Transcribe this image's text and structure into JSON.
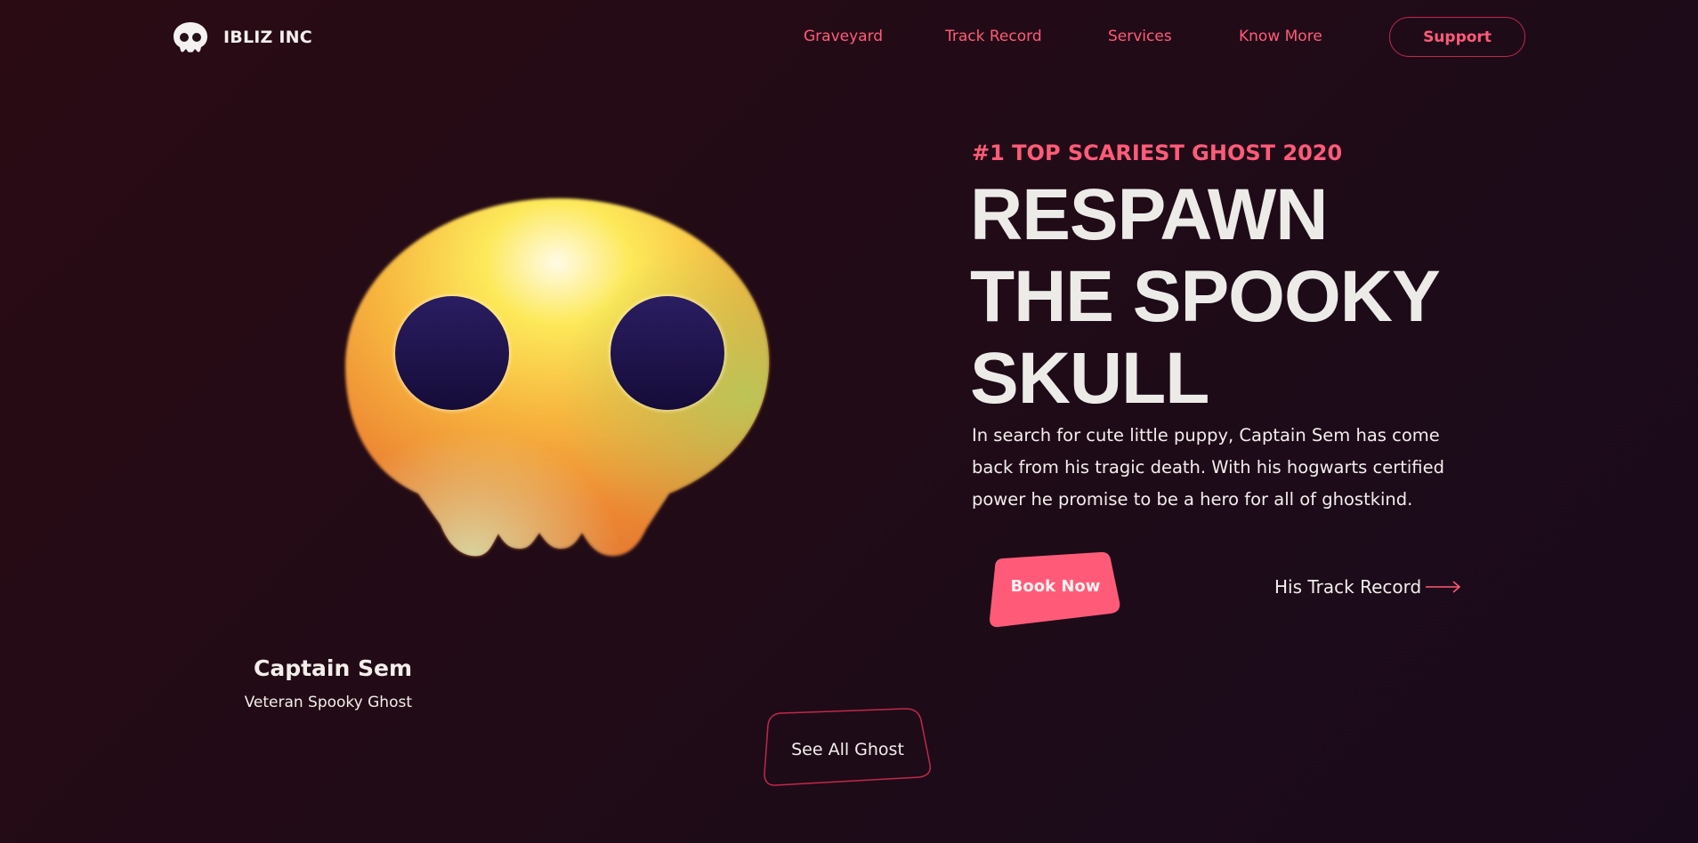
{
  "brand": {
    "name": "IBLIZ INC",
    "logo_icon": "skull-icon"
  },
  "nav": {
    "links": [
      "Graveyard",
      "Track Record",
      "Services",
      "Know More"
    ],
    "support_label": "Support"
  },
  "hero": {
    "eyebrow": "#1 TOP SCARIEST GHOST 2020",
    "headline": [
      "RESPAWN",
      "THE SPOOKY",
      "SKULL"
    ],
    "description": "In search for cute little puppy, Captain Sem has come back from his tragic death. With his hogwarts certified power he promise to be a hero for all of ghostkind.",
    "book_label": "Book Now",
    "track_label": "His Track Record",
    "track_icon": "arrow-right-icon"
  },
  "character": {
    "name": "Captain Sem",
    "role": "Veteran Spooky Ghost",
    "art_icon": "skull-illustration"
  },
  "see_all_label": "See All Ghost",
  "colors": {
    "accent": "#ff5b78",
    "background": "#220b16",
    "text": "#ecebe8",
    "skull_yellow": "#fbe44a",
    "skull_orange": "#f29a3c",
    "eye": "#1f1548"
  }
}
